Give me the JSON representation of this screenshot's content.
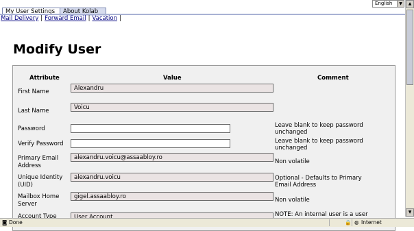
{
  "tabs": [
    {
      "label": "My User Settings",
      "active": true
    },
    {
      "label": "About Kolab",
      "active": false
    }
  ],
  "language": {
    "selected": "English"
  },
  "subnav": [
    "Mail Delivery",
    "Forward Email",
    "Vacation"
  ],
  "page_title": "Modify User",
  "table": {
    "headers": {
      "attribute": "Attribute",
      "value": "Value",
      "comment": "Comment"
    },
    "rows": [
      {
        "label": "First Name",
        "value": "Alexandru",
        "comment": ""
      },
      {
        "label": "Last Name",
        "value": "Voicu",
        "comment": ""
      },
      {
        "label": "Password",
        "value": "",
        "comment": "Leave blank to keep password unchanged"
      },
      {
        "label": "Verify Password",
        "value": "",
        "comment": "Leave blank to keep password unchanged"
      },
      {
        "label": "Primary Email Address",
        "value": "alexandru.voicu@assaabloy.ro",
        "comment": "Non volatile"
      },
      {
        "label": "Unique Identity (UID)",
        "value": "alexandru.voicu",
        "comment": "Optional - Defaults to Primary Email Address"
      },
      {
        "label": "Mailbox Home Server",
        "value": "gigel.assaabloy.ro",
        "comment": "Non volatile"
      },
      {
        "label": "Account Type",
        "value": "User Account",
        "comment": "NOTE: An internal user is a user that"
      }
    ]
  },
  "statusbar": {
    "text": "Done",
    "zone": "Internet"
  },
  "colors": {
    "tab_inactive": "#d7dcee",
    "panel": "#f0f0f0",
    "field_readonly": "#eae3e3",
    "link": "#000080"
  }
}
